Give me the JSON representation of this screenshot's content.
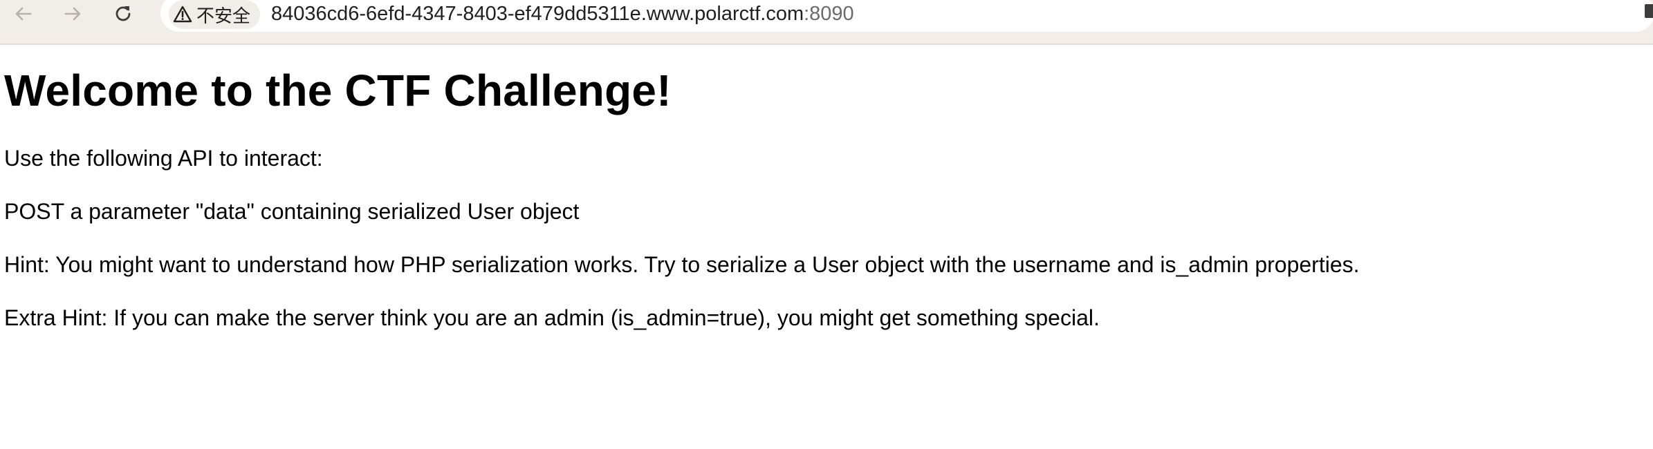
{
  "browser": {
    "security_label": "不安全",
    "url_host": "84036cd6-6efd-4347-8403-ef479dd5311e.www.polarctf.com",
    "url_port": ":8090",
    "icons": {
      "back": "arrow-left-icon",
      "forward": "arrow-right-icon",
      "reload": "reload-icon",
      "warning": "warning-triangle-icon"
    }
  },
  "page": {
    "heading": "Welcome to the CTF Challenge!",
    "paragraphs": [
      "Use the following API to interact:",
      "POST a parameter \"data\" containing serialized User object",
      "Hint: You might want to understand how PHP serialization works. Try to serialize a User object with the username and is_admin properties.",
      "Extra Hint: If you can make the server think you are an admin (is_admin=true), you might get something special."
    ]
  }
}
